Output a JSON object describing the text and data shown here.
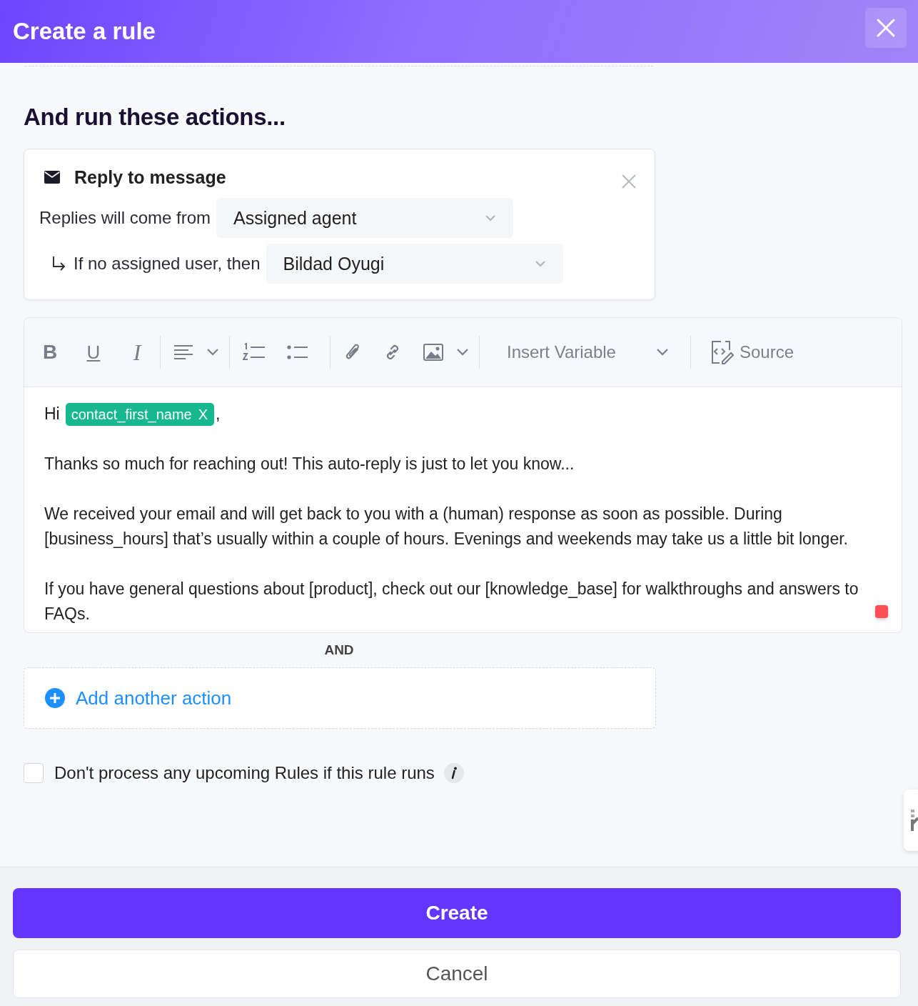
{
  "dialog": {
    "title": "Create a rule"
  },
  "section_heading": "And run these actions...",
  "action_card": {
    "title": "Reply to message",
    "rows": [
      {
        "kind": "main",
        "label": "Replies will come from",
        "value": "Assigned agent"
      },
      {
        "kind": "fallback",
        "label": "If no assigned user, then",
        "value": "Bildad Oyugi"
      }
    ]
  },
  "editor": {
    "toolbar": [
      {
        "kind": "bold",
        "label": "B"
      },
      {
        "kind": "underline",
        "label": "U"
      },
      {
        "kind": "italic",
        "label": "I"
      },
      {
        "kind": "divider"
      },
      {
        "kind": "align"
      },
      {
        "kind": "caret"
      },
      {
        "kind": "divider"
      },
      {
        "kind": "ordered"
      },
      {
        "kind": "bullets"
      },
      {
        "kind": "divider"
      },
      {
        "kind": "attach"
      },
      {
        "kind": "link"
      },
      {
        "kind": "image"
      },
      {
        "kind": "caret"
      },
      {
        "kind": "divider"
      },
      {
        "kind": "variable",
        "label": "Insert Variable"
      },
      {
        "kind": "divider"
      },
      {
        "kind": "source",
        "label": "Source"
      }
    ],
    "greeting": {
      "text": "Hi",
      "variable": "contact_first_name",
      "remove": "X",
      "after": ","
    },
    "paragraphs": [
      "Thanks so much for reaching out! This auto-reply is just to let you know...",
      "We received your email and will get back to you with a (human) response as soon as possible. During [business_hours] that’s usually within a couple of hours. Evenings and weekends may take us a little bit longer.",
      "If you have general questions about [product], check out our [knowledge_base] for walkthroughs and answers to FAQs."
    ]
  },
  "joiner": "AND",
  "add_action": "Add another action",
  "stop_option": {
    "label": "Don't process any upcoming Rules if this rule runs",
    "checked": false
  },
  "buttons": {
    "primary": "Create",
    "secondary": "Cancel"
  }
}
